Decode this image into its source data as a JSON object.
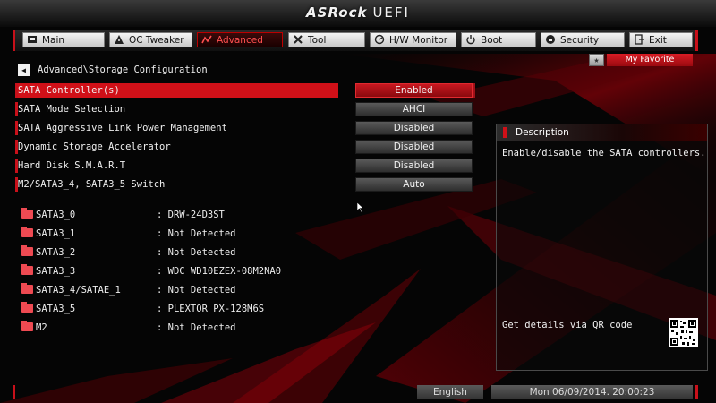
{
  "header": {
    "brand": "ASRock",
    "product": "UEFI"
  },
  "tabs": [
    {
      "label": "Main",
      "icon": "main-icon"
    },
    {
      "label": "OC Tweaker",
      "icon": "oc-tweaker-icon"
    },
    {
      "label": "Advanced",
      "icon": "advanced-icon",
      "active": true
    },
    {
      "label": "Tool",
      "icon": "tool-icon"
    },
    {
      "label": "H/W Monitor",
      "icon": "hw-monitor-icon"
    },
    {
      "label": "Boot",
      "icon": "boot-icon"
    },
    {
      "label": "Security",
      "icon": "security-icon"
    },
    {
      "label": "Exit",
      "icon": "exit-icon"
    }
  ],
  "favorite": {
    "label": "My Favorite",
    "star": "★"
  },
  "breadcrumb": {
    "back": "◀",
    "path": "Advanced\\Storage Configuration"
  },
  "settings": [
    {
      "label": "SATA Controller(s)",
      "value": "Enabled",
      "selected": true
    },
    {
      "label": "SATA Mode Selection",
      "value": "AHCI"
    },
    {
      "label": "SATA Aggressive Link Power Management",
      "value": "Disabled"
    },
    {
      "label": "Dynamic Storage Accelerator",
      "value": "Disabled"
    },
    {
      "label": "Hard Disk S.M.A.R.T",
      "value": "Disabled"
    },
    {
      "label": "M2/SATA3_4, SATA3_5 Switch",
      "value": "Auto"
    }
  ],
  "drives": [
    {
      "port": "SATA3_0",
      "device": ": DRW-24D3ST"
    },
    {
      "port": "SATA3_1",
      "device": ": Not Detected"
    },
    {
      "port": "SATA3_2",
      "device": ": Not Detected"
    },
    {
      "port": "SATA3_3",
      "device": ": WDC WD10EZEX-08M2NA0"
    },
    {
      "port": "SATA3_4/SATAE_1",
      "device": ": Not Detected"
    },
    {
      "port": "SATA3_5",
      "device": ": PLEXTOR PX-128M6S"
    },
    {
      "port": "M2",
      "device": ": Not Detected"
    }
  ],
  "description": {
    "title": "Description",
    "text": "Enable/disable the SATA controllers.",
    "qr_label": "Get details via QR code"
  },
  "footer": {
    "language": "English",
    "datetime": "Mon 06/09/2014. 20:00:23"
  },
  "colors": {
    "accent": "#d01018",
    "background": "#050505"
  }
}
